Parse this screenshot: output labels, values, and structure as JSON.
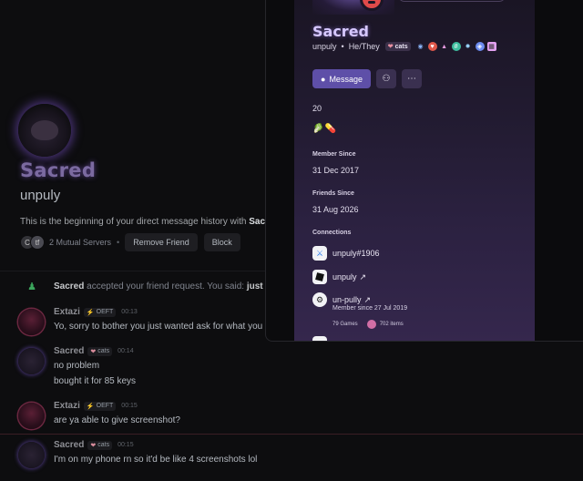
{
  "chat": {
    "profile_name": "Sacred",
    "profile_username": "unpuly",
    "intro_text": "This is the beginning of your direct message history with ",
    "intro_name": "Sac",
    "mutual_servers": "2 Mutual Servers",
    "mutual_server_initials": [
      "C",
      "tf"
    ],
    "remove_friend_label": "Remove Friend",
    "block_label": "Block",
    "system_message": {
      "name": "Sacred",
      "text": " accepted your friend request. You said: ",
      "quote": "just"
    },
    "messages": [
      {
        "author": "Extazi",
        "tag": "OEFT",
        "time": "00:13",
        "lines": [
          "Yo, sorry to bother you just wanted ask for what you"
        ]
      },
      {
        "author": "Sacred",
        "tag": "cats",
        "time": "00:14",
        "lines": [
          "no problem",
          "bought it for 85 keys"
        ]
      },
      {
        "author": "Extazi",
        "tag": "OEFT",
        "time": "00:15",
        "lines": [
          "are ya able to give screenshot?"
        ]
      },
      {
        "author": "Sacred",
        "tag": "cats",
        "time": "00:15",
        "lines": [
          "I'm on my phone rn so it'd be like 4 screenshots lol"
        ]
      }
    ]
  },
  "profile": {
    "display_name": "Sacred",
    "username": "unpuly",
    "pronouns": "He/They",
    "guild_tag": "cats",
    "message_button": "Message",
    "bio_number": "20",
    "bio_emojis": [
      "🥬",
      "💊"
    ],
    "member_since_label": "Member Since",
    "member_since": "31 Dec 2017",
    "friends_since_label": "Friends Since",
    "friends_since": "31 Aug 2026",
    "connections_label": "Connections",
    "connections": [
      {
        "name": "unpuly#1906",
        "icon": "battlenet-icon"
      },
      {
        "name": "unpuly",
        "icon": "roblox-icon"
      },
      {
        "name": "un-pully",
        "icon": "steam-icon",
        "sub": "Member since 27 Jul 2019",
        "games": "79 Games",
        "items": "702 items"
      }
    ]
  }
}
